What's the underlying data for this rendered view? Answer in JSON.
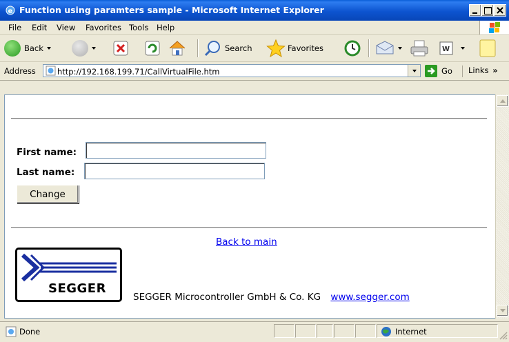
{
  "window": {
    "title": "Function using paramters sample - Microsoft Internet Explorer"
  },
  "menu": {
    "items": [
      "File",
      "Edit",
      "View",
      "Favorites",
      "Tools",
      "Help"
    ]
  },
  "toolbar": {
    "back_label": "Back",
    "search_label": "Search",
    "favorites_label": "Favorites"
  },
  "address": {
    "label": "Address",
    "url": "http://192.168.199.71/CallVirtualFile.htm",
    "go_label": "Go",
    "links_label": "Links"
  },
  "form": {
    "first_name_label": "First name:",
    "first_name_value": "",
    "last_name_label": "Last name:",
    "last_name_value": "",
    "change_button": "Change"
  },
  "page": {
    "back_link": "Back to main",
    "logo_text": "SEGGER",
    "company": "SEGGER Microcontroller GmbH & Co. KG",
    "website": "www.segger.com"
  },
  "status": {
    "text": "Done",
    "zone": "Internet"
  },
  "colors": {
    "titlebar": "#0a54d0",
    "link": "#0000ee",
    "chrome": "#ece9d8"
  }
}
